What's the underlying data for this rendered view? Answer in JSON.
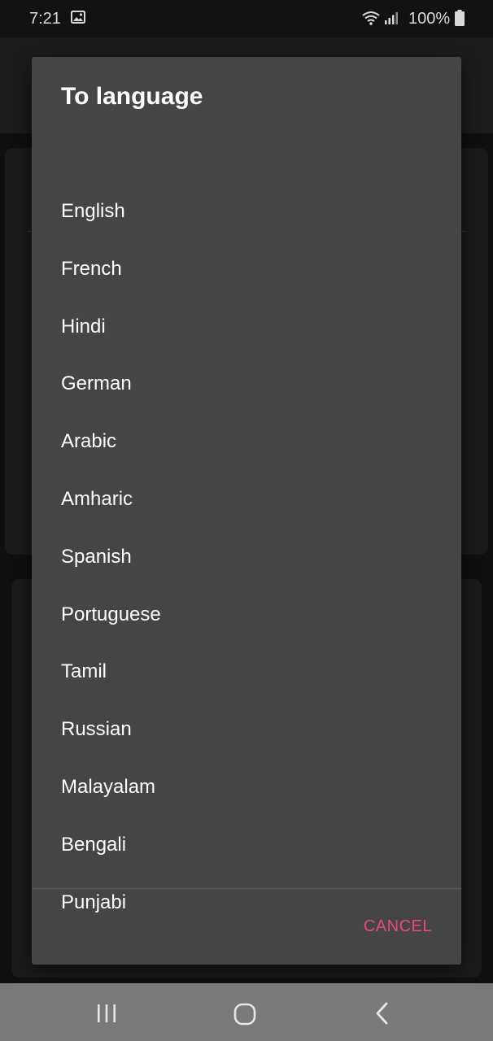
{
  "status_bar": {
    "time": "7:21",
    "battery": "100%",
    "icons": [
      "gallery-icon",
      "wifi-icon",
      "signal-icon",
      "battery-icon"
    ]
  },
  "dialog": {
    "title": "To language",
    "options": [
      "English",
      "French",
      "Hindi",
      "German",
      "Arabic",
      "Amharic",
      "Spanish",
      "Portuguese",
      "Tamil",
      "Russian",
      "Malayalam",
      "Bengali",
      "Punjabi"
    ],
    "cancel_label": "CANCEL",
    "accent_color": "#e8497b",
    "background_color": "#454545"
  },
  "nav_bar": {
    "icons": [
      "recents-icon",
      "home-icon",
      "back-icon"
    ]
  }
}
